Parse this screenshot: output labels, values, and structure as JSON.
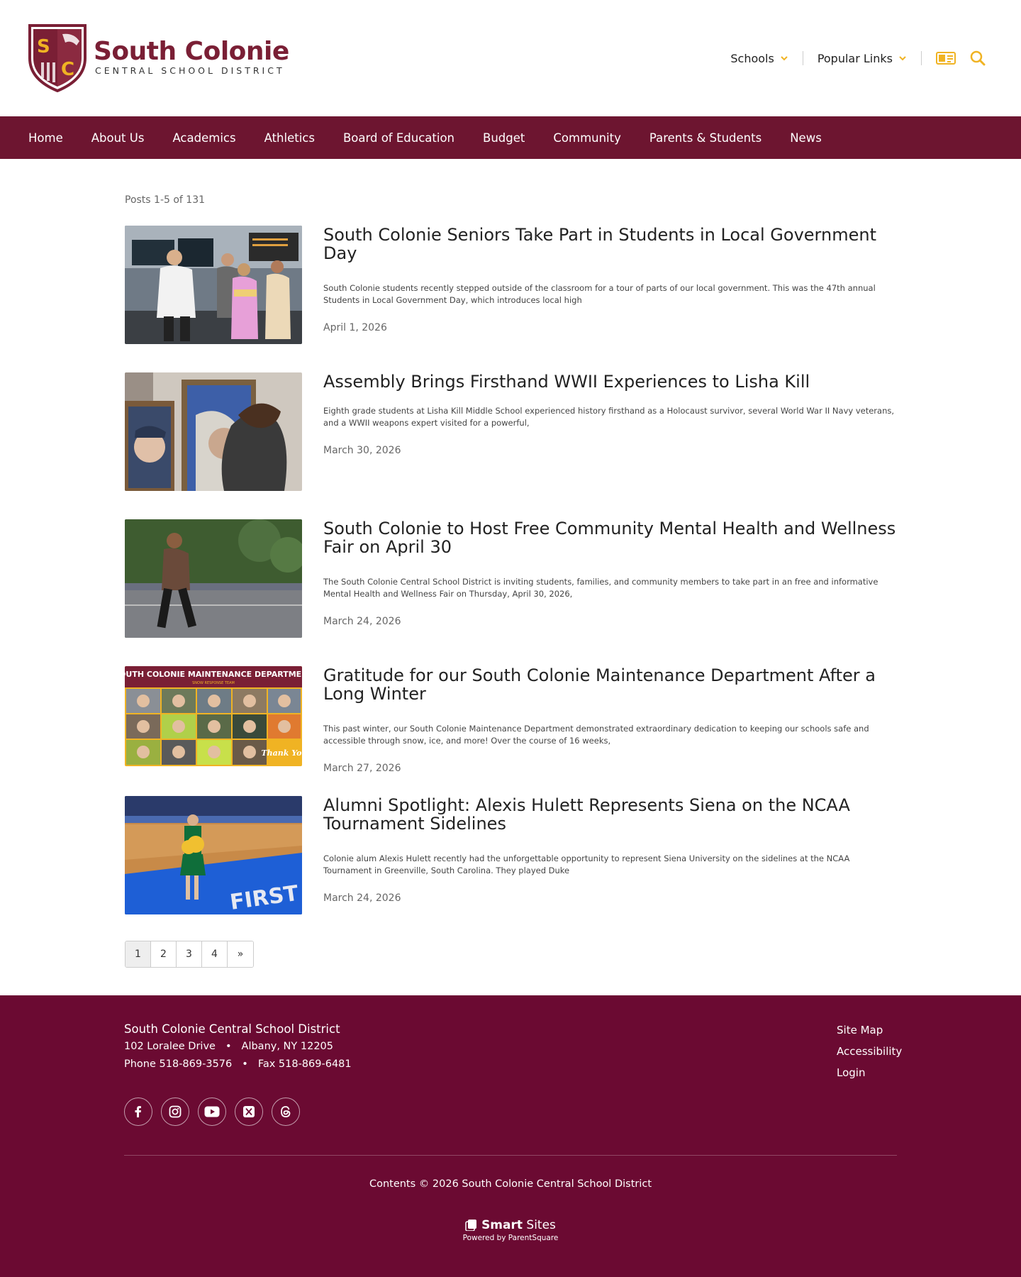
{
  "header": {
    "logo_initials": "SC",
    "logo_name": "South Colonie",
    "logo_sub": "CENTRAL SCHOOL DISTRICT",
    "util": [
      {
        "label": "Schools"
      },
      {
        "label": "Popular Links"
      }
    ],
    "icons": [
      "id-card-icon",
      "search-icon"
    ]
  },
  "nav": [
    "Home",
    "About Us",
    "Academics",
    "Athletics",
    "Board of Education",
    "Budget",
    "Community",
    "Parents & Students",
    "News"
  ],
  "content": {
    "post_count": "Posts 1-5 of 131",
    "posts": [
      {
        "title": "South Colonie Seniors Take Part in Students in Local Government Day",
        "excerpt": "South Colonie students recently stepped outside of the classroom for a tour of parts of our local government. This was the 47th annual Students in Local Government Day, which introduces local high",
        "date": "April 1, 2026"
      },
      {
        "title": "Assembly Brings Firsthand WWII Experiences to Lisha Kill",
        "excerpt": "Eighth grade students at Lisha Kill Middle School experienced history firsthand as a Holocaust survivor, several World War II Navy veterans, and a WWII weapons expert visited for a powerful,",
        "date": "March 30, 2026"
      },
      {
        "title": "South Colonie to Host Free Community Mental Health and Wellness Fair on April 30",
        "excerpt": "The South Colonie Central School District is inviting students, families, and community members to take part in an free and informative Mental Health and Wellness Fair on Thursday, April 30, 2026,",
        "date": "March 24, 2026"
      },
      {
        "title": "Gratitude for our South Colonie Maintenance Department After a Long Winter",
        "excerpt": "This past winter, our South Colonie Maintenance Department demonstrated extraordinary dedication to keeping our schools safe and accessible through snow, ice, and more! Over the course of 16 weeks,",
        "date": "March 27, 2026",
        "thumb_banner": "SOUTH COLONIE MAINTENANCE DEPARTMENT",
        "thumb_sub": "SNOW RESPONSE TEAM",
        "thumb_badge": "Thank You"
      },
      {
        "title": "Alumni Spotlight: Alexis Hulett Represents Siena on the NCAA Tournament Sidelines",
        "excerpt": "Colonie alum Alexis Hulett recently had the unforgettable opportunity to represent Siena University on the sidelines at the NCAA Tournament in Greenville, South Carolina. They played Duke",
        "date": "March 24, 2026",
        "thumb_floor": "FIRST"
      }
    ]
  },
  "pager": [
    "1",
    "2",
    "3",
    "4",
    "»"
  ],
  "footer": {
    "org": "South Colonie Central School District",
    "address1": "102 Loralee Drive",
    "address2": "Albany, NY 12205",
    "phone": "Phone 518-869-3576",
    "fax": "Fax 518-869-6481",
    "bullet": "•",
    "links": [
      "Site Map",
      "Accessibility",
      "Login"
    ],
    "socials": [
      "facebook-icon",
      "instagram-icon",
      "youtube-icon",
      "x-icon",
      "threads-icon"
    ],
    "copyright": "Contents © 2026 South Colonie Central School District",
    "brand_bold": "Smart",
    "brand_light": "Sites",
    "powered": "Powered by ParentSquare"
  },
  "colors": {
    "maroon": "#6d1530",
    "footer": "#6b0a32",
    "gold": "#f0b323"
  }
}
